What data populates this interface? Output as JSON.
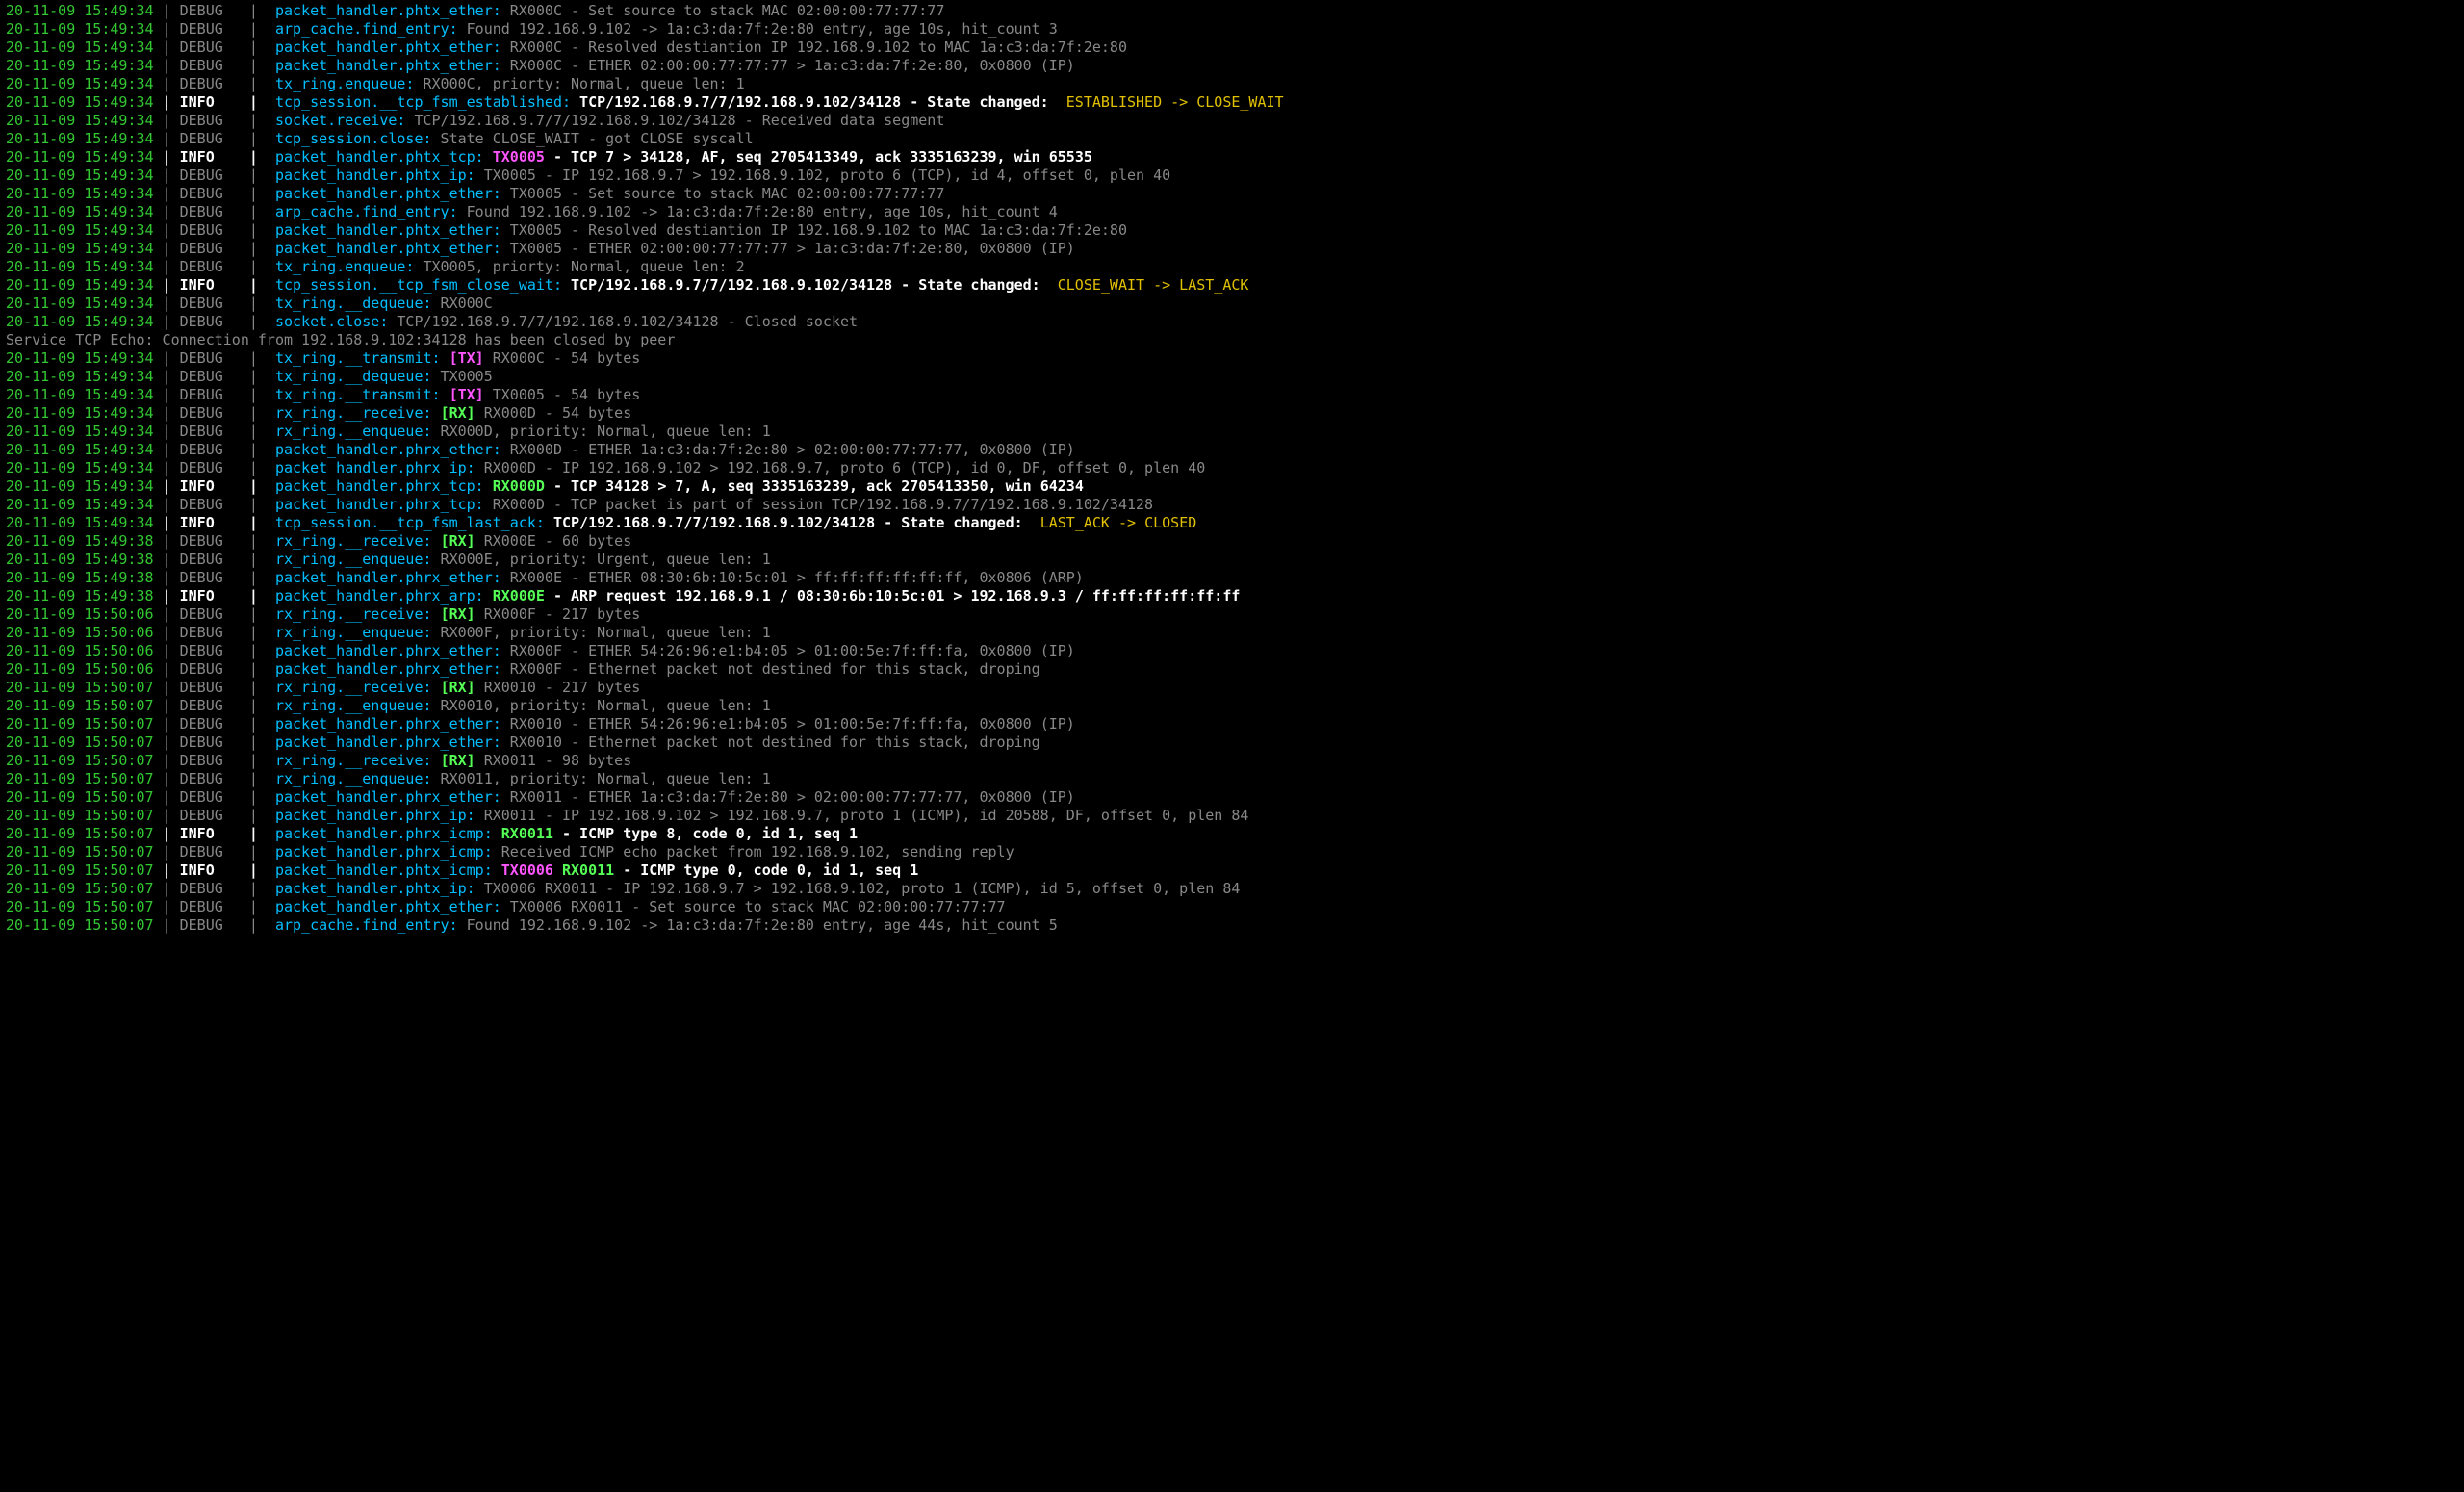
{
  "lines": [
    {
      "ts": "20-11-09 15:49:34",
      "lvl": "DEBUG",
      "src": "packet_handler.phtx_ether:",
      "segs": [
        {
          "c": "mgy",
          "t": " RX000C - Set source to stack MAC 02:00:00:77:77:77"
        }
      ]
    },
    {
      "ts": "20-11-09 15:49:34",
      "lvl": "DEBUG",
      "src": "arp_cache.find_entry:",
      "segs": [
        {
          "c": "mgy",
          "t": " Found 192.168.9.102 -> 1a:c3:da:7f:2e:80 entry, age 10s, hit_count 3"
        }
      ]
    },
    {
      "ts": "20-11-09 15:49:34",
      "lvl": "DEBUG",
      "src": "packet_handler.phtx_ether:",
      "segs": [
        {
          "c": "mgy",
          "t": " RX000C - Resolved destiantion IP 192.168.9.102 to MAC 1a:c3:da:7f:2e:80"
        }
      ]
    },
    {
      "ts": "20-11-09 15:49:34",
      "lvl": "DEBUG",
      "src": "packet_handler.phtx_ether:",
      "segs": [
        {
          "c": "mgy",
          "t": " RX000C - ETHER 02:00:00:77:77:77 > 1a:c3:da:7f:2e:80, 0x0800 (IP)"
        }
      ]
    },
    {
      "ts": "20-11-09 15:49:34",
      "lvl": "DEBUG",
      "src": "tx_ring.enqueue:",
      "segs": [
        {
          "c": "mgy",
          "t": " RX000C, priorty: Normal, queue len: 1"
        }
      ]
    },
    {
      "ts": "20-11-09 15:49:34",
      "lvl": "INFO",
      "src": "tcp_session.__tcp_fsm_established:",
      "segs": [
        {
          "c": "mwt",
          "t": " TCP/192.168.9.7/7/192.168.9.102/34128 - State changed:  "
        },
        {
          "c": "myl",
          "t": "ESTABLISHED -> CLOSE_WAIT"
        }
      ]
    },
    {
      "ts": "20-11-09 15:49:34",
      "lvl": "DEBUG",
      "src": "socket.receive:",
      "segs": [
        {
          "c": "mgy",
          "t": " TCP/192.168.9.7/7/192.168.9.102/34128 - Received data segment"
        }
      ]
    },
    {
      "ts": "20-11-09 15:49:34",
      "lvl": "DEBUG",
      "src": "tcp_session.close:",
      "segs": [
        {
          "c": "mgy",
          "t": " State CLOSE_WAIT - got CLOSE syscall"
        }
      ]
    },
    {
      "ts": "20-11-09 15:49:34",
      "lvl": "INFO",
      "src": "packet_handler.phtx_tcp:",
      "segs": [
        {
          "c": "mwt",
          "t": " "
        },
        {
          "c": "mtx",
          "t": "TX0005"
        },
        {
          "c": "mwt",
          "t": " - TCP 7 > 34128, AF, seq 2705413349, ack 3335163239, win 65535"
        }
      ]
    },
    {
      "ts": "20-11-09 15:49:34",
      "lvl": "DEBUG",
      "src": "packet_handler.phtx_ip:",
      "segs": [
        {
          "c": "mgy",
          "t": " TX0005 - IP 192.168.9.7 > 192.168.9.102, proto 6 (TCP), id 4, offset 0, plen 40"
        }
      ]
    },
    {
      "ts": "20-11-09 15:49:34",
      "lvl": "DEBUG",
      "src": "packet_handler.phtx_ether:",
      "segs": [
        {
          "c": "mgy",
          "t": " TX0005 - Set source to stack MAC 02:00:00:77:77:77"
        }
      ]
    },
    {
      "ts": "20-11-09 15:49:34",
      "lvl": "DEBUG",
      "src": "arp_cache.find_entry:",
      "segs": [
        {
          "c": "mgy",
          "t": " Found 192.168.9.102 -> 1a:c3:da:7f:2e:80 entry, age 10s, hit_count 4"
        }
      ]
    },
    {
      "ts": "20-11-09 15:49:34",
      "lvl": "DEBUG",
      "src": "packet_handler.phtx_ether:",
      "segs": [
        {
          "c": "mgy",
          "t": " TX0005 - Resolved destiantion IP 192.168.9.102 to MAC 1a:c3:da:7f:2e:80"
        }
      ]
    },
    {
      "ts": "20-11-09 15:49:34",
      "lvl": "DEBUG",
      "src": "packet_handler.phtx_ether:",
      "segs": [
        {
          "c": "mgy",
          "t": " TX0005 - ETHER 02:00:00:77:77:77 > 1a:c3:da:7f:2e:80, 0x0800 (IP)"
        }
      ]
    },
    {
      "ts": "20-11-09 15:49:34",
      "lvl": "DEBUG",
      "src": "tx_ring.enqueue:",
      "segs": [
        {
          "c": "mgy",
          "t": " TX0005, priorty: Normal, queue len: 2"
        }
      ]
    },
    {
      "ts": "20-11-09 15:49:34",
      "lvl": "INFO",
      "src": "tcp_session.__tcp_fsm_close_wait:",
      "segs": [
        {
          "c": "mwt",
          "t": " TCP/192.168.9.7/7/192.168.9.102/34128 - State changed:  "
        },
        {
          "c": "myl",
          "t": "CLOSE_WAIT -> LAST_ACK"
        }
      ]
    },
    {
      "ts": "20-11-09 15:49:34",
      "lvl": "DEBUG",
      "src": "tx_ring.__dequeue:",
      "segs": [
        {
          "c": "mgy",
          "t": " RX000C"
        }
      ]
    },
    {
      "ts": "20-11-09 15:49:34",
      "lvl": "DEBUG",
      "src": "socket.close:",
      "segs": [
        {
          "c": "mgy",
          "t": " TCP/192.168.9.7/7/192.168.9.102/34128 - Closed socket"
        }
      ]
    },
    {
      "raw": "Service TCP Echo: Connection from 192.168.9.102:34128 has been closed by peer"
    },
    {
      "ts": "20-11-09 15:49:34",
      "lvl": "DEBUG",
      "src": "tx_ring.__transmit:",
      "segs": [
        {
          "c": "mgy",
          "t": " "
        },
        {
          "c": "mtx",
          "t": "[TX]"
        },
        {
          "c": "mgy",
          "t": " RX000C - 54 bytes"
        }
      ]
    },
    {
      "ts": "20-11-09 15:49:34",
      "lvl": "DEBUG",
      "src": "tx_ring.__dequeue:",
      "segs": [
        {
          "c": "mgy",
          "t": " TX0005"
        }
      ]
    },
    {
      "ts": "20-11-09 15:49:34",
      "lvl": "DEBUG",
      "src": "tx_ring.__transmit:",
      "segs": [
        {
          "c": "mgy",
          "t": " "
        },
        {
          "c": "mtx",
          "t": "[TX]"
        },
        {
          "c": "mgy",
          "t": " TX0005 - 54 bytes"
        }
      ]
    },
    {
      "ts": "20-11-09 15:49:34",
      "lvl": "DEBUG",
      "src": "rx_ring.__receive:",
      "segs": [
        {
          "c": "mgy",
          "t": " "
        },
        {
          "c": "mrx",
          "t": "[RX]"
        },
        {
          "c": "mgy",
          "t": " RX000D - 54 bytes"
        }
      ]
    },
    {
      "ts": "20-11-09 15:49:34",
      "lvl": "DEBUG",
      "src": "rx_ring.__enqueue:",
      "segs": [
        {
          "c": "mgy",
          "t": " RX000D, priority: Normal, queue len: 1"
        }
      ]
    },
    {
      "ts": "20-11-09 15:49:34",
      "lvl": "DEBUG",
      "src": "packet_handler.phrx_ether:",
      "segs": [
        {
          "c": "mgy",
          "t": " RX000D - ETHER 1a:c3:da:7f:2e:80 > 02:00:00:77:77:77, 0x0800 (IP)"
        }
      ]
    },
    {
      "ts": "20-11-09 15:49:34",
      "lvl": "DEBUG",
      "src": "packet_handler.phrx_ip:",
      "segs": [
        {
          "c": "mgy",
          "t": " RX000D - IP 192.168.9.102 > 192.168.9.7, proto 6 (TCP), id 0, DF, offset 0, plen 40"
        }
      ]
    },
    {
      "ts": "20-11-09 15:49:34",
      "lvl": "INFO",
      "src": "packet_handler.phrx_tcp:",
      "segs": [
        {
          "c": "mwt",
          "t": " "
        },
        {
          "c": "mrx",
          "t": "RX000D"
        },
        {
          "c": "mwt",
          "t": " - TCP 34128 > 7, A, seq 3335163239, ack 2705413350, win 64234"
        }
      ]
    },
    {
      "ts": "20-11-09 15:49:34",
      "lvl": "DEBUG",
      "src": "packet_handler.phrx_tcp:",
      "segs": [
        {
          "c": "mgy",
          "t": " RX000D - TCP packet is part of session TCP/192.168.9.7/7/192.168.9.102/34128"
        }
      ]
    },
    {
      "ts": "20-11-09 15:49:34",
      "lvl": "INFO",
      "src": "tcp_session.__tcp_fsm_last_ack:",
      "segs": [
        {
          "c": "mwt",
          "t": " TCP/192.168.9.7/7/192.168.9.102/34128 - State changed:  "
        },
        {
          "c": "myl",
          "t": "LAST_ACK -> CLOSED"
        }
      ]
    },
    {
      "ts": "20-11-09 15:49:38",
      "lvl": "DEBUG",
      "src": "rx_ring.__receive:",
      "segs": [
        {
          "c": "mgy",
          "t": " "
        },
        {
          "c": "mrx",
          "t": "[RX]"
        },
        {
          "c": "mgy",
          "t": " RX000E - 60 bytes"
        }
      ]
    },
    {
      "ts": "20-11-09 15:49:38",
      "lvl": "DEBUG",
      "src": "rx_ring.__enqueue:",
      "segs": [
        {
          "c": "mgy",
          "t": " RX000E, priority: Urgent, queue len: 1"
        }
      ]
    },
    {
      "ts": "20-11-09 15:49:38",
      "lvl": "DEBUG",
      "src": "packet_handler.phrx_ether:",
      "segs": [
        {
          "c": "mgy",
          "t": " RX000E - ETHER 08:30:6b:10:5c:01 > ff:ff:ff:ff:ff:ff, 0x0806 (ARP)"
        }
      ]
    },
    {
      "ts": "20-11-09 15:49:38",
      "lvl": "INFO",
      "src": "packet_handler.phrx_arp:",
      "segs": [
        {
          "c": "mwt",
          "t": " "
        },
        {
          "c": "mrx",
          "t": "RX000E"
        },
        {
          "c": "mwt",
          "t": " - ARP request 192.168.9.1 / 08:30:6b:10:5c:01 > 192.168.9.3 / ff:ff:ff:ff:ff:ff"
        }
      ]
    },
    {
      "ts": "20-11-09 15:50:06",
      "lvl": "DEBUG",
      "src": "rx_ring.__receive:",
      "segs": [
        {
          "c": "mgy",
          "t": " "
        },
        {
          "c": "mrx",
          "t": "[RX]"
        },
        {
          "c": "mgy",
          "t": " RX000F - 217 bytes"
        }
      ]
    },
    {
      "ts": "20-11-09 15:50:06",
      "lvl": "DEBUG",
      "src": "rx_ring.__enqueue:",
      "segs": [
        {
          "c": "mgy",
          "t": " RX000F, priority: Normal, queue len: 1"
        }
      ]
    },
    {
      "ts": "20-11-09 15:50:06",
      "lvl": "DEBUG",
      "src": "packet_handler.phrx_ether:",
      "segs": [
        {
          "c": "mgy",
          "t": " RX000F - ETHER 54:26:96:e1:b4:05 > 01:00:5e:7f:ff:fa, 0x0800 (IP)"
        }
      ]
    },
    {
      "ts": "20-11-09 15:50:06",
      "lvl": "DEBUG",
      "src": "packet_handler.phrx_ether:",
      "segs": [
        {
          "c": "mgy",
          "t": " RX000F - Ethernet packet not destined for this stack, droping"
        }
      ]
    },
    {
      "ts": "20-11-09 15:50:07",
      "lvl": "DEBUG",
      "src": "rx_ring.__receive:",
      "segs": [
        {
          "c": "mgy",
          "t": " "
        },
        {
          "c": "mrx",
          "t": "[RX]"
        },
        {
          "c": "mgy",
          "t": " RX0010 - 217 bytes"
        }
      ]
    },
    {
      "ts": "20-11-09 15:50:07",
      "lvl": "DEBUG",
      "src": "rx_ring.__enqueue:",
      "segs": [
        {
          "c": "mgy",
          "t": " RX0010, priority: Normal, queue len: 1"
        }
      ]
    },
    {
      "ts": "20-11-09 15:50:07",
      "lvl": "DEBUG",
      "src": "packet_handler.phrx_ether:",
      "segs": [
        {
          "c": "mgy",
          "t": " RX0010 - ETHER 54:26:96:e1:b4:05 > 01:00:5e:7f:ff:fa, 0x0800 (IP)"
        }
      ]
    },
    {
      "ts": "20-11-09 15:50:07",
      "lvl": "DEBUG",
      "src": "packet_handler.phrx_ether:",
      "segs": [
        {
          "c": "mgy",
          "t": " RX0010 - Ethernet packet not destined for this stack, droping"
        }
      ]
    },
    {
      "ts": "20-11-09 15:50:07",
      "lvl": "DEBUG",
      "src": "rx_ring.__receive:",
      "segs": [
        {
          "c": "mgy",
          "t": " "
        },
        {
          "c": "mrx",
          "t": "[RX]"
        },
        {
          "c": "mgy",
          "t": " RX0011 - 98 bytes"
        }
      ]
    },
    {
      "ts": "20-11-09 15:50:07",
      "lvl": "DEBUG",
      "src": "rx_ring.__enqueue:",
      "segs": [
        {
          "c": "mgy",
          "t": " RX0011, priority: Normal, queue len: 1"
        }
      ]
    },
    {
      "ts": "20-11-09 15:50:07",
      "lvl": "DEBUG",
      "src": "packet_handler.phrx_ether:",
      "segs": [
        {
          "c": "mgy",
          "t": " RX0011 - ETHER 1a:c3:da:7f:2e:80 > 02:00:00:77:77:77, 0x0800 (IP)"
        }
      ]
    },
    {
      "ts": "20-11-09 15:50:07",
      "lvl": "DEBUG",
      "src": "packet_handler.phrx_ip:",
      "segs": [
        {
          "c": "mgy",
          "t": " RX0011 - IP 192.168.9.102 > 192.168.9.7, proto 1 (ICMP), id 20588, DF, offset 0, plen 84"
        }
      ]
    },
    {
      "ts": "20-11-09 15:50:07",
      "lvl": "INFO",
      "src": "packet_handler.phrx_icmp:",
      "segs": [
        {
          "c": "mwt",
          "t": " "
        },
        {
          "c": "mrx",
          "t": "RX0011"
        },
        {
          "c": "mwt",
          "t": " - ICMP type 8, code 0, id 1, seq 1"
        }
      ]
    },
    {
      "ts": "20-11-09 15:50:07",
      "lvl": "DEBUG",
      "src": "packet_handler.phrx_icmp:",
      "segs": [
        {
          "c": "mgy",
          "t": " Received ICMP echo packet from 192.168.9.102, sending reply"
        }
      ]
    },
    {
      "ts": "20-11-09 15:50:07",
      "lvl": "INFO",
      "src": "packet_handler.phtx_icmp:",
      "segs": [
        {
          "c": "mwt",
          "t": " "
        },
        {
          "c": "mtx",
          "t": "TX0006"
        },
        {
          "c": "mwt",
          "t": " "
        },
        {
          "c": "mrx",
          "t": "RX0011"
        },
        {
          "c": "mwt",
          "t": " - ICMP type 0, code 0, id 1, seq 1"
        }
      ]
    },
    {
      "ts": "20-11-09 15:50:07",
      "lvl": "DEBUG",
      "src": "packet_handler.phtx_ip:",
      "segs": [
        {
          "c": "mgy",
          "t": " TX0006 RX0011 - IP 192.168.9.7 > 192.168.9.102, proto 1 (ICMP), id 5, offset 0, plen 84"
        }
      ]
    },
    {
      "ts": "20-11-09 15:50:07",
      "lvl": "DEBUG",
      "src": "packet_handler.phtx_ether:",
      "segs": [
        {
          "c": "mgy",
          "t": " TX0006 RX0011 - Set source to stack MAC 02:00:00:77:77:77"
        }
      ]
    },
    {
      "ts": "20-11-09 15:50:07",
      "lvl": "DEBUG",
      "src": "arp_cache.find_entry:",
      "segs": [
        {
          "c": "mgy",
          "t": " Found 192.168.9.102 -> 1a:c3:da:7f:2e:80 entry, age 44s, hit_count 5"
        }
      ]
    }
  ]
}
